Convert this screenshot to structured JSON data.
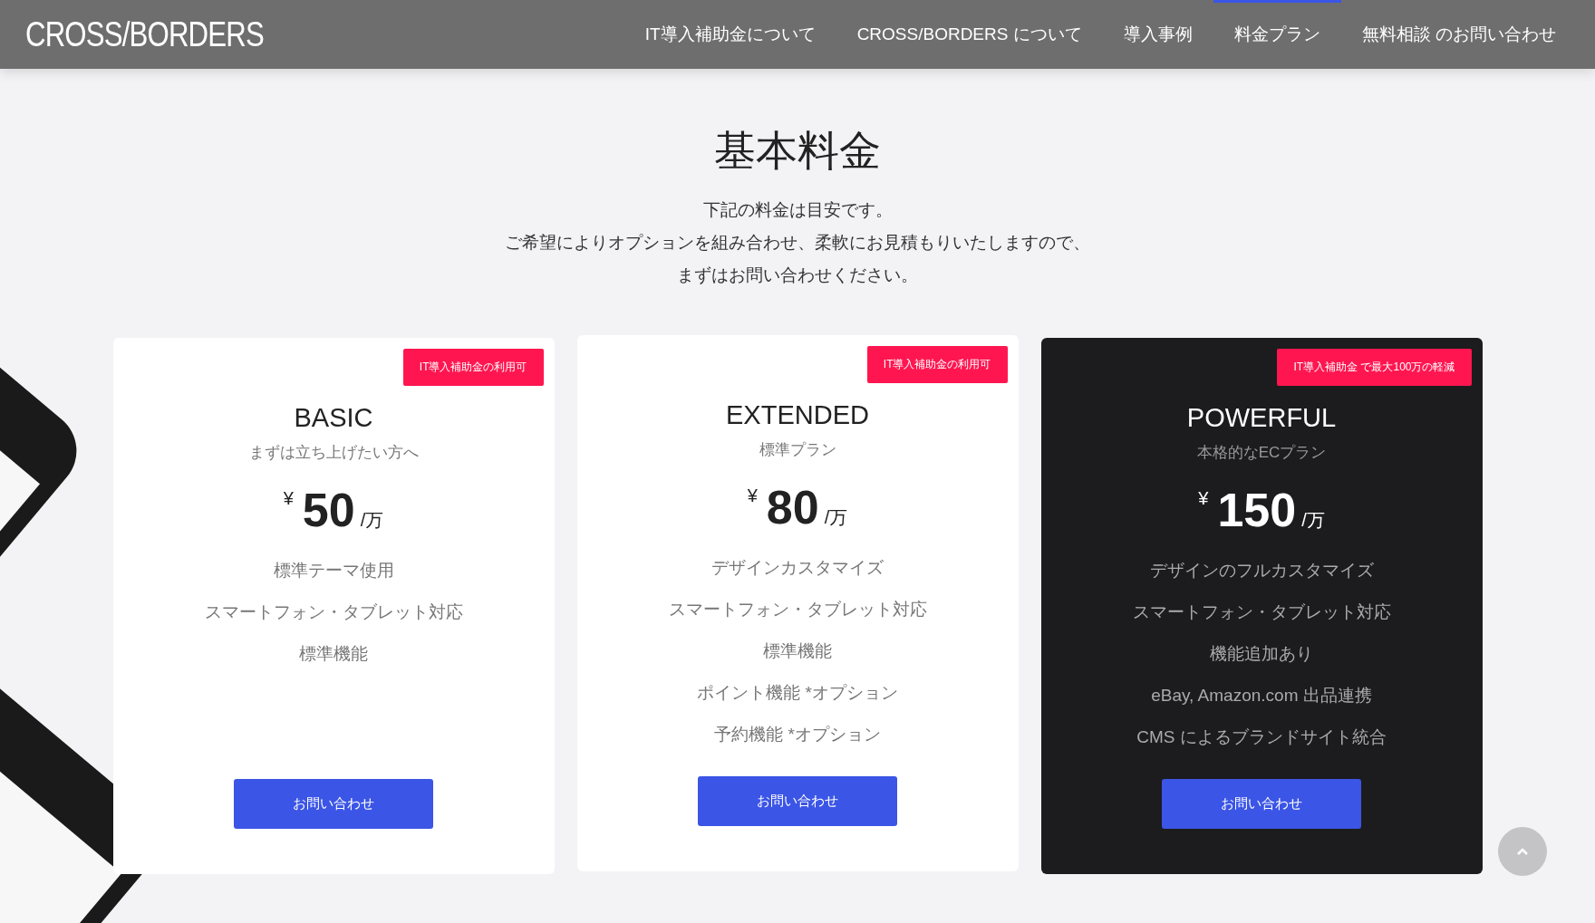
{
  "header": {
    "logo": "CROSS/BORDERS",
    "nav": [
      {
        "label": "IT導入補助金について",
        "selected": false
      },
      {
        "label": "CROSS/BORDERS について",
        "selected": false
      },
      {
        "label": "導入事例",
        "selected": false
      },
      {
        "label": "料金プラン",
        "selected": true
      },
      {
        "label": "無料相談 のお問い合わせ",
        "selected": false
      }
    ]
  },
  "pricing": {
    "title": "基本料金",
    "intro": [
      "下記の料金は目安です。",
      "ご希望によりオプションを組み合わせ、柔軟にお見積もりいたしますので、",
      "まずはお問い合わせください。"
    ],
    "plans": [
      {
        "badge": "IT導入補助金の利用可",
        "name": "BASIC",
        "subtitle": "まずは立ち上げたい方へ",
        "currency": "¥",
        "price": "50",
        "unit": "/万",
        "features": [
          "標準テーマ使用",
          "スマートフォン・タブレット対応",
          "標準機能"
        ],
        "button": "お問い合わせ",
        "highlighted": false
      },
      {
        "badge": "IT導入補助金の利用可",
        "name": "EXTENDED",
        "subtitle": "標準プラン",
        "currency": "¥",
        "price": "80",
        "unit": "/万",
        "features": [
          "デザインカスタマイズ",
          "スマートフォン・タブレット対応",
          "標準機能",
          "ポイント機能 *オプション",
          "予約機能 *オプション"
        ],
        "button": "お問い合わせ",
        "highlighted": false
      },
      {
        "badge": "IT導入補助金 で最大100万の軽減",
        "name": "POWERFUL",
        "subtitle": "本格的なECプラン",
        "currency": "¥",
        "price": "150",
        "unit": "/万",
        "features": [
          "デザインのフルカスタマイズ",
          "スマートフォン・タブレット対応",
          "機能追加あり",
          "eBay, Amazon.com 出品連携",
          "CMS によるブランドサイト統合"
        ],
        "button": "お問い合わせ",
        "highlighted": true
      }
    ]
  }
}
